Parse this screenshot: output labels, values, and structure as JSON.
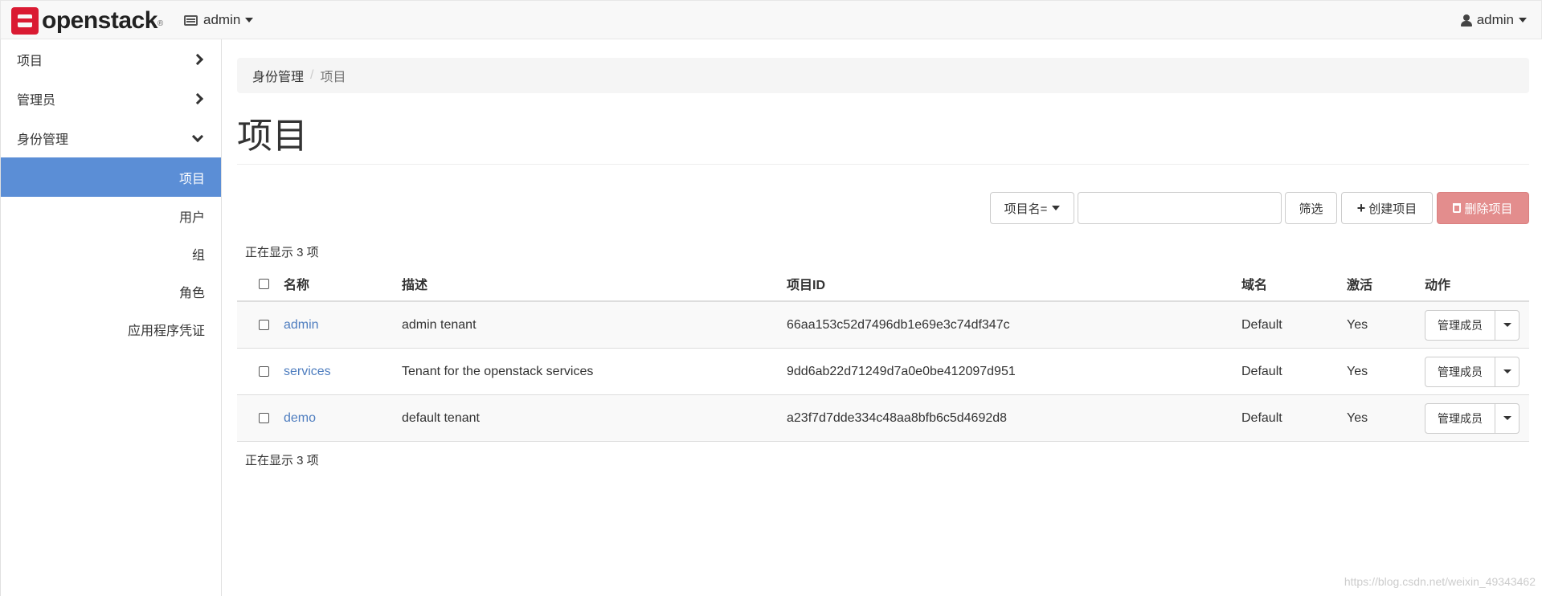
{
  "navbar": {
    "brand": "openstack",
    "brand_mark": "®",
    "project_label": "admin",
    "user_label": "admin"
  },
  "sidebar": {
    "sections": [
      {
        "label": "项目",
        "state": "collapsed"
      },
      {
        "label": "管理员",
        "state": "collapsed"
      },
      {
        "label": "身份管理",
        "state": "expanded"
      }
    ],
    "identity_items": [
      {
        "label": "项目",
        "active": true
      },
      {
        "label": "用户",
        "active": false
      },
      {
        "label": "组",
        "active": false
      },
      {
        "label": "角色",
        "active": false
      },
      {
        "label": "应用程序凭证",
        "active": false
      }
    ]
  },
  "breadcrumb": {
    "parent": "身份管理",
    "separator": "/",
    "current": "项目"
  },
  "page": {
    "title": "项目"
  },
  "toolbar": {
    "filter_field": "项目名=",
    "filter_value": "",
    "filter_button": "筛选",
    "create_button": "创建项目",
    "delete_button": "删除项目"
  },
  "count_text": "正在显示 3 项",
  "table": {
    "headers": {
      "name": "名称",
      "description": "描述",
      "project_id": "项目ID",
      "domain": "域名",
      "enabled": "激活",
      "actions": "动作"
    },
    "rows": [
      {
        "name": "admin",
        "description": "admin tenant",
        "project_id": "66aa153c52d7496db1e69e3c74df347c",
        "domain": "Default",
        "enabled": "Yes",
        "action": "管理成员"
      },
      {
        "name": "services",
        "description": "Tenant for the openstack services",
        "project_id": "9dd6ab22d71249d7a0e0be412097d951",
        "domain": "Default",
        "enabled": "Yes",
        "action": "管理成员"
      },
      {
        "name": "demo",
        "description": "default tenant",
        "project_id": "a23f7d7dde334c48aa8bfb6c5d4692d8",
        "domain": "Default",
        "enabled": "Yes",
        "action": "管理成员"
      }
    ]
  },
  "watermark": "https://blog.csdn.net/weixin_49343462",
  "colors": {
    "brand_red": "#da1a32",
    "active_nav": "#5b8ed6",
    "link": "#4e7dbf",
    "danger_button": "#e38d8d"
  }
}
